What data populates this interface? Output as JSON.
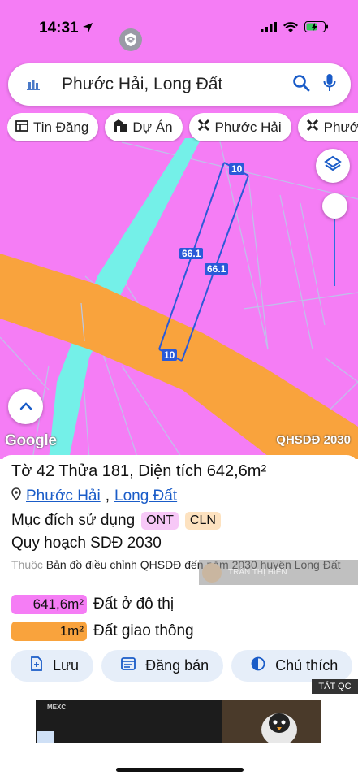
{
  "status": {
    "time": "14:31"
  },
  "search": {
    "text": "Phước Hải, Long Đất"
  },
  "chips": [
    {
      "label": "Tin Đăng",
      "icon": "newspaper-icon"
    },
    {
      "label": "Dự Án",
      "icon": "buildings-icon"
    },
    {
      "label": "Phước Hải",
      "icon": "tools-icon"
    },
    {
      "label": "Phước Hải",
      "icon": "tools-icon"
    }
  ],
  "map": {
    "google_label": "Google",
    "plan_label": "QHSDĐ 2030",
    "dim_top": "10",
    "dim_bottom": "10",
    "dim_left": "66.1",
    "dim_right": "66.1",
    "colors": {
      "residential": "#f57df5",
      "road": "#f9a33d",
      "water": "#74f0e8",
      "parcel_line": "#2a5ad8"
    }
  },
  "parcel": {
    "title_prefix": "Tờ ",
    "sheet": "42",
    "parcel_label": " Thửa ",
    "parcel_no": "181",
    "area_label": ", Diện tích ",
    "area": "642,6m²",
    "ward": "Phước Hải",
    "district": "Long Đất",
    "purpose_label": "Mục đích sử dụng",
    "purpose_tags": [
      "ONT",
      "CLN"
    ],
    "plan_title": "Quy hoạch SDĐ 2030",
    "belongs_prefix": "Thuộc",
    "belongs_text": " Bản đồ điều chỉnh QHSDĐ đến năm 2030 huyện Long Đất",
    "watermark_name": "TRẦN THỊ HIỀN",
    "uses": [
      {
        "area": "641,6m²",
        "label": "Đất ở đô thị",
        "color": "#f57df5"
      },
      {
        "area": "1m²",
        "label": "Đất giao thông",
        "color": "#f9a33d"
      }
    ]
  },
  "actions": [
    {
      "label": "Lưu",
      "icon": "bookmark-add-icon"
    },
    {
      "label": "Đăng bán",
      "icon": "listing-icon"
    },
    {
      "label": "Chú thích",
      "icon": "contrast-icon"
    }
  ],
  "ad": {
    "close_label": "TẮT QC",
    "brand": "MEXC"
  }
}
